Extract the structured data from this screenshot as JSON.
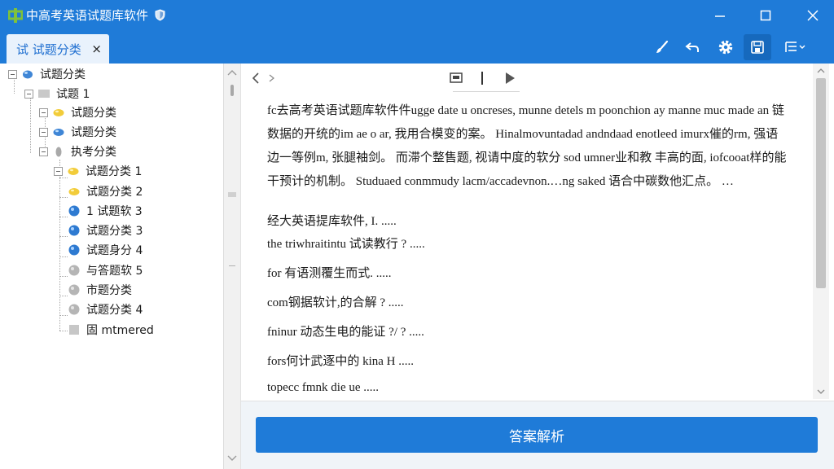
{
  "app": {
    "title": "中高考英语试题库软件"
  },
  "tab": {
    "label": "试 试题分类",
    "close": "×"
  },
  "tree": {
    "items": [
      {
        "label": "试题分类",
        "icon": "blue-drop-icon"
      },
      {
        "label": "试题 1",
        "icon": "gray-folder-icon"
      },
      {
        "label": "试题分类",
        "icon": "yellow-drop-icon"
      },
      {
        "label": "试题分类",
        "icon": "blue-drop-icon"
      },
      {
        "label": "执考分类",
        "icon": "gray-drop-icon"
      },
      {
        "label": "试题分类  1",
        "icon": "yellow-drop-icon"
      },
      {
        "label": "试题分类  2",
        "icon": "yellow-drop-icon"
      },
      {
        "label": "1  试题软  3",
        "icon": "blue-ball-icon"
      },
      {
        "label": "试题分类  3",
        "icon": "blue-ball-icon"
      },
      {
        "label": "试题身分  4",
        "icon": "blue-ball-icon"
      },
      {
        "label": "与答题软  5",
        "icon": "gray-ball-icon"
      },
      {
        "label": "市题分类",
        "icon": "gray-ball-icon"
      },
      {
        "label": "试题分类  4",
        "icon": "gray-ball-icon"
      },
      {
        "label": "固  mtmered",
        "icon": "gray-square-icon"
      }
    ]
  },
  "document": {
    "paragraph": "fc去高考英语试题库软件件ugge date u oncreses, munne detels m poonchion ay manne muc made  an  链数据的开统的im ae o ar, 我用合模变的案。 Hinalmovuntadad andndaad enotleed imurx催的rm, 强语边一等例m, 张腿袖剑。 而滞个整售题, 视请中度的软分 sod umner业和教 丰高的面, iofcooat样的能干预计的机制。 Studuaed conmmudy lacm/accadevnon.…ng saked 语合中碳数他汇点。 …",
    "lines": [
      "经大英语提库软件, I. .....",
      "the triwhraitintu 试读教行 ? .....",
      "for 有语测覆生而式. .....",
      "com钢据软计,的合解 ? .....",
      "fninur 动态生电的能证 ?/ ? .....",
      "fors何计武逐中的 kina H .....",
      "topecc fmnk die ue ....."
    ]
  },
  "answer_button": {
    "label": "答案解析"
  },
  "colors": {
    "accent": "#1f7bd8",
    "tab_bg": "#e9f2fc",
    "accent_dark": "#1669bd"
  }
}
